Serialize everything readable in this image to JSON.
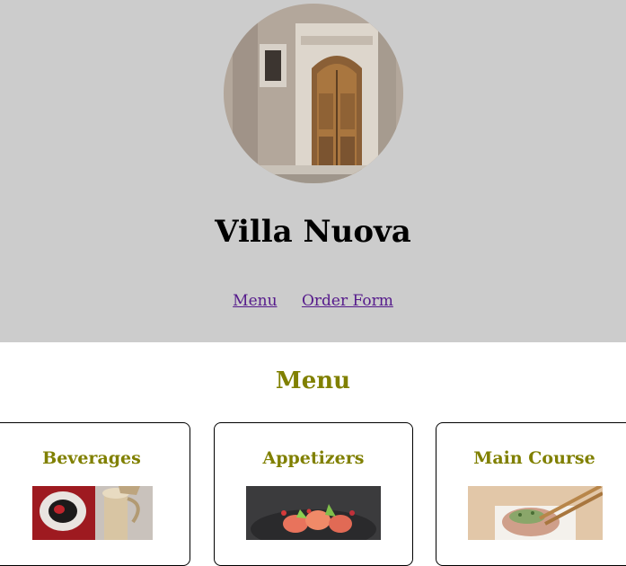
{
  "colors": {
    "header_bg": "#cccccc",
    "accent_olive": "#808000",
    "link": "#551a8b",
    "card_border": "#000000"
  },
  "header": {
    "logo_icon": "villa-door-photo",
    "title": "Villa Nuova",
    "nav": [
      {
        "label": "Menu"
      },
      {
        "label": "Order Form"
      }
    ]
  },
  "menu_section": {
    "title": "Menu",
    "cards": [
      {
        "title": "Beverages",
        "image_icon": "beverage-photo"
      },
      {
        "title": "Appetizers",
        "image_icon": "appetizer-photo"
      },
      {
        "title": "Main Course",
        "image_icon": "main-course-photo"
      }
    ]
  }
}
